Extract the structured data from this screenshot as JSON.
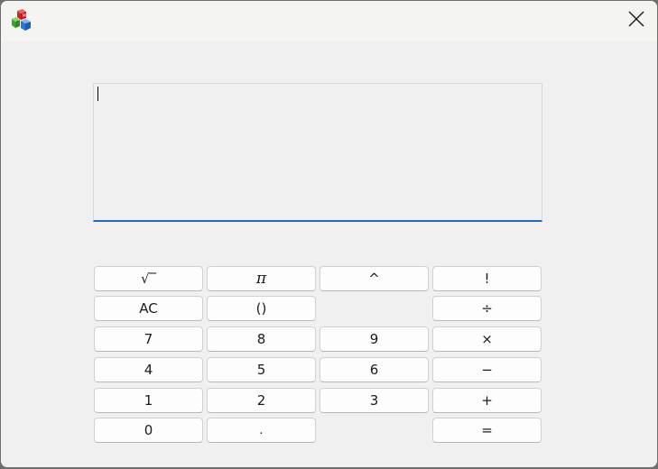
{
  "window": {
    "app_icon": "blocks-icon",
    "close_icon": "close-icon"
  },
  "display": {
    "value": ""
  },
  "keys": {
    "sqrt": "√‾",
    "pi": "π",
    "caret": "^",
    "factorial": "!",
    "ac": "AC",
    "parens": "()",
    "divide": "÷",
    "seven": "7",
    "eight": "8",
    "nine": "9",
    "multiply": "×",
    "four": "4",
    "five": "5",
    "six": "6",
    "minus": "−",
    "one": "1",
    "two": "2",
    "three": "3",
    "plus": "+",
    "zero": "0",
    "dot": ".",
    "equals": "="
  },
  "colors": {
    "accent": "#1a6dc7",
    "window_bg": "#f0f0f0",
    "key_bg": "#fdfdfd"
  }
}
